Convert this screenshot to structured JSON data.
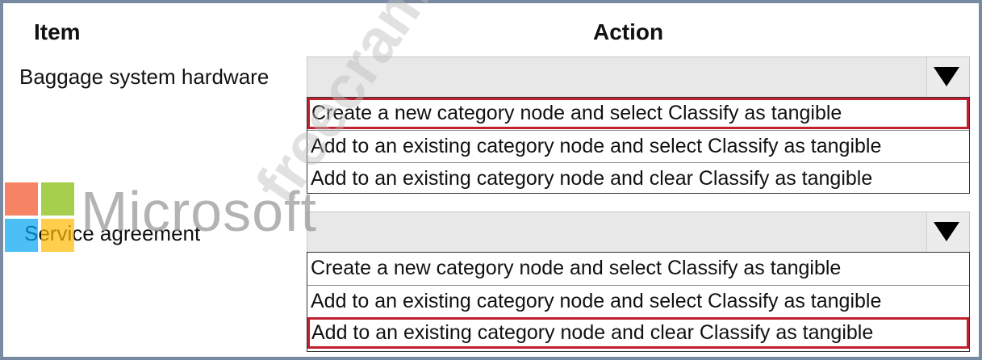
{
  "headers": {
    "item": "Item",
    "action": "Action"
  },
  "rows": [
    {
      "item_label": "Baggage system hardware",
      "options": [
        "Create a new category node and select Classify as tangible",
        "Add to an existing category node and select Classify as tangible",
        "Add to an existing category node and clear Classify as tangible"
      ],
      "selected_index": 0
    },
    {
      "item_label": "Service agreement",
      "options": [
        "Create a new category node and select Classify as tangible",
        "Add to an existing category node and select Classify as tangible",
        "Add to an existing category node and clear Classify as tangible"
      ],
      "selected_index": 2
    }
  ],
  "overlay": {
    "logo_text": "Microsoft",
    "watermark_text": "freecram.net",
    "logo_colors": [
      "#f25022",
      "#7fba00",
      "#00a4ef",
      "#ffb900"
    ]
  },
  "colors": {
    "highlight": "#c0202e"
  }
}
